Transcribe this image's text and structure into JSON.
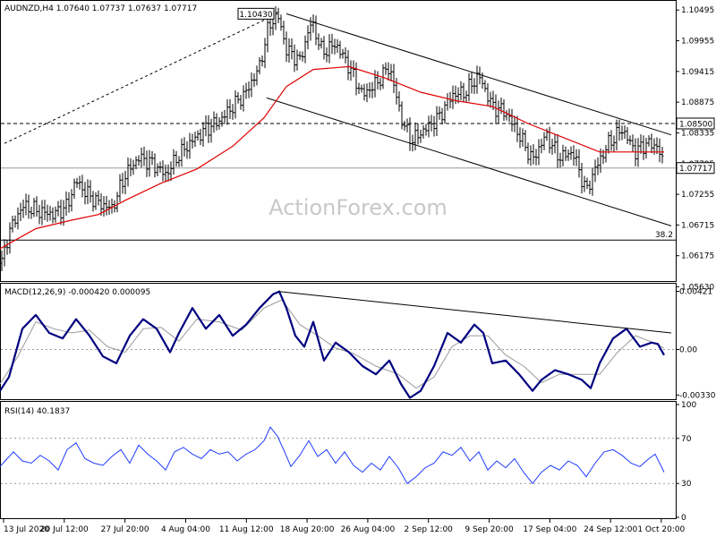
{
  "window": {
    "symbol_line": "AUDNZD,H4  1.07640 1.07737 1.07637 1.07717"
  },
  "watermark": "ActionForex.com",
  "colors": {
    "bars": "#000000",
    "ma": "#e00000",
    "macd": "#000080",
    "signal": "#9a9a9a",
    "rsi": "#1e3cff",
    "levels": "#000000"
  },
  "chart_data": [
    {
      "type": "ohlc",
      "panel": "price",
      "title": "AUDNZD,H4  1.07640 1.07737 1.07637 1.07717",
      "ylim": [
        1.0573,
        1.1064
      ],
      "y_ticks": [
        "1.10495",
        "1.09955",
        "1.09415",
        "1.08875",
        "1.08335",
        "1.07795",
        "1.07255",
        "1.06715",
        "1.06175",
        "1.05630"
      ],
      "x_ticks": [
        "13 Jul 2020",
        "20 Jul 12:00",
        "27 Jul 20:00",
        "4 Aug 04:00",
        "11 Aug 12:00",
        "18 Aug 20:00",
        "26 Aug 04:00",
        "2 Sep 12:00",
        "9 Sep 20:00",
        "17 Sep 04:00",
        "24 Sep 12:00",
        "1 Oct 20:00"
      ],
      "close_path": [
        [
          0,
          1.059
        ],
        [
          10,
          1.066
        ],
        [
          25,
          1.0705
        ],
        [
          45,
          1.0695
        ],
        [
          60,
          1.069
        ],
        [
          75,
          1.0705
        ],
        [
          85,
          1.075
        ],
        [
          95,
          1.073
        ],
        [
          110,
          1.071
        ],
        [
          125,
          1.07
        ],
        [
          140,
          1.076
        ],
        [
          155,
          1.079
        ],
        [
          170,
          1.078
        ],
        [
          185,
          1.076
        ],
        [
          200,
          1.0795
        ],
        [
          215,
          1.082
        ],
        [
          230,
          1.084
        ],
        [
          245,
          1.0855
        ],
        [
          260,
          1.088
        ],
        [
          275,
          1.0905
        ],
        [
          290,
          1.095
        ],
        [
          300,
          1.102
        ],
        [
          310,
          1.1043
        ],
        [
          320,
          1.098
        ],
        [
          335,
          1.096
        ],
        [
          348,
          1.103
        ],
        [
          360,
          1.0975
        ],
        [
          375,
          1.099
        ],
        [
          390,
          1.095
        ],
        [
          405,
          1.09
        ],
        [
          420,
          1.092
        ],
        [
          435,
          1.095
        ],
        [
          450,
          1.085
        ],
        [
          460,
          1.082
        ],
        [
          475,
          1.084
        ],
        [
          490,
          1.086
        ],
        [
          505,
          1.09
        ],
        [
          520,
          1.0905
        ],
        [
          535,
          1.0935
        ],
        [
          550,
          1.088
        ],
        [
          565,
          1.087
        ],
        [
          580,
          1.083
        ],
        [
          595,
          1.0785
        ],
        [
          610,
          1.083
        ],
        [
          625,
          1.079
        ],
        [
          640,
          1.08
        ],
        [
          655,
          1.073
        ],
        [
          665,
          1.077
        ],
        [
          680,
          1.0815
        ],
        [
          695,
          1.084
        ],
        [
          710,
          1.08
        ],
        [
          722,
          1.0815
        ],
        [
          735,
          1.081
        ],
        [
          742,
          1.0772
        ]
      ],
      "ma_path": [
        [
          0,
          1.063
        ],
        [
          40,
          1.0665
        ],
        [
          80,
          1.068
        ],
        [
          110,
          1.069
        ],
        [
          140,
          1.0715
        ],
        [
          180,
          1.0745
        ],
        [
          220,
          1.077
        ],
        [
          260,
          1.081
        ],
        [
          295,
          1.086
        ],
        [
          320,
          1.0915
        ],
        [
          350,
          1.0945
        ],
        [
          390,
          1.095
        ],
        [
          430,
          1.093
        ],
        [
          470,
          1.0905
        ],
        [
          510,
          1.089
        ],
        [
          550,
          1.088
        ],
        [
          590,
          1.085
        ],
        [
          630,
          1.0825
        ],
        [
          670,
          1.08
        ],
        [
          700,
          1.08
        ],
        [
          742,
          1.08
        ]
      ],
      "levels": [
        {
          "label": "1.08500",
          "value": 1.085,
          "style": "dashed"
        },
        {
          "label": "1.07717",
          "value": 1.07717,
          "style": "solid-grey",
          "highlight": true
        },
        {
          "label": "38.2",
          "value": 1.0645,
          "style": "solid"
        }
      ],
      "peak_label": "1.10430",
      "trendlines": [
        {
          "from": [
            5,
            1.0815
          ],
          "to": [
            310,
            1.1043
          ],
          "style": "dotted"
        },
        {
          "from": [
            320,
            1.1043
          ],
          "to": [
            750,
            1.083
          ],
          "style": "solid"
        },
        {
          "from": [
            298,
            1.0895
          ],
          "to": [
            750,
            1.067
          ],
          "style": "solid"
        }
      ]
    },
    {
      "type": "line",
      "panel": "macd",
      "title": "MACD(12,26,9) -0.000420 0.000095",
      "ylim": [
        -0.0036,
        0.0047
      ],
      "y_ticks": [
        "0.00421",
        "0.00",
        "-0.003302"
      ],
      "series": [
        {
          "name": "MACD",
          "values": [
            [
              0,
              -0.003
            ],
            [
              10,
              -0.002
            ],
            [
              25,
              0.0015
            ],
            [
              40,
              0.0025
            ],
            [
              55,
              0.0012
            ],
            [
              70,
              0.0008
            ],
            [
              85,
              0.0022
            ],
            [
              100,
              0.001
            ],
            [
              115,
              -0.0005
            ],
            [
              130,
              -0.001
            ],
            [
              145,
              0.001
            ],
            [
              160,
              0.0022
            ],
            [
              175,
              0.0015
            ],
            [
              190,
              -0.0002
            ],
            [
              200,
              0.0012
            ],
            [
              215,
              0.003
            ],
            [
              230,
              0.0015
            ],
            [
              245,
              0.0025
            ],
            [
              260,
              0.001
            ],
            [
              275,
              0.0018
            ],
            [
              290,
              0.003
            ],
            [
              305,
              0.004
            ],
            [
              312,
              0.0042
            ],
            [
              320,
              0.003
            ],
            [
              330,
              0.001
            ],
            [
              340,
              0.0002
            ],
            [
              350,
              0.002
            ],
            [
              362,
              -0.0008
            ],
            [
              375,
              0.0005
            ],
            [
              390,
              -0.0002
            ],
            [
              405,
              -0.0012
            ],
            [
              420,
              -0.0018
            ],
            [
              435,
              -0.0008
            ],
            [
              448,
              -0.0025
            ],
            [
              458,
              -0.0035
            ],
            [
              470,
              -0.003
            ],
            [
              485,
              -0.0012
            ],
            [
              500,
              0.0012
            ],
            [
              515,
              0.0005
            ],
            [
              530,
              0.0018
            ],
            [
              540,
              0.0012
            ],
            [
              550,
              -0.001
            ],
            [
              565,
              -0.0008
            ],
            [
              580,
              -0.0018
            ],
            [
              595,
              -0.003
            ],
            [
              605,
              -0.0022
            ],
            [
              620,
              -0.0015
            ],
            [
              635,
              -0.0018
            ],
            [
              650,
              -0.0022
            ],
            [
              660,
              -0.0028
            ],
            [
              670,
              -0.001
            ],
            [
              685,
              0.0008
            ],
            [
              700,
              0.0015
            ],
            [
              715,
              0.0002
            ],
            [
              728,
              0.0005
            ],
            [
              735,
              0.0004
            ],
            [
              742,
              -0.0004
            ]
          ]
        },
        {
          "name": "Signal",
          "values": [
            [
              0,
              -0.0025
            ],
            [
              20,
              -0.0005
            ],
            [
              40,
              0.002
            ],
            [
              60,
              0.0015
            ],
            [
              80,
              0.0012
            ],
            [
              100,
              0.0014
            ],
            [
              120,
              0.0002
            ],
            [
              140,
              -0.0002
            ],
            [
              160,
              0.0015
            ],
            [
              180,
              0.0016
            ],
            [
              200,
              0.0006
            ],
            [
              220,
              0.0022
            ],
            [
              245,
              0.002
            ],
            [
              270,
              0.0014
            ],
            [
              295,
              0.003
            ],
            [
              315,
              0.0036
            ],
            [
              335,
              0.0018
            ],
            [
              355,
              0.001
            ],
            [
              375,
              0.0001
            ],
            [
              395,
              -0.0003
            ],
            [
              420,
              -0.0012
            ],
            [
              445,
              -0.0018
            ],
            [
              465,
              -0.0028
            ],
            [
              485,
              -0.002
            ],
            [
              505,
              0.0002
            ],
            [
              525,
              0.001
            ],
            [
              545,
              0.001
            ],
            [
              565,
              -0.0004
            ],
            [
              585,
              -0.0012
            ],
            [
              605,
              -0.0024
            ],
            [
              625,
              -0.0018
            ],
            [
              650,
              -0.0018
            ],
            [
              670,
              -0.0018
            ],
            [
              690,
              -0.0002
            ],
            [
              710,
              0.001
            ],
            [
              730,
              0.0005
            ],
            [
              742,
              0.0001
            ]
          ]
        }
      ],
      "trendlines": [
        {
          "from": [
            312,
            0.0042
          ],
          "to": [
            750,
            0.0012
          ],
          "style": "solid"
        }
      ]
    },
    {
      "type": "line",
      "panel": "rsi",
      "title": "RSI(14) 40.1837",
      "ylim": [
        0,
        100
      ],
      "y_ticks": [
        "100",
        "70",
        "30",
        "0"
      ],
      "levels": [
        70,
        30
      ],
      "series": [
        {
          "name": "RSI",
          "values": [
            [
              0,
              45
            ],
            [
              8,
              52
            ],
            [
              15,
              58
            ],
            [
              25,
              50
            ],
            [
              35,
              48
            ],
            [
              45,
              55
            ],
            [
              55,
              50
            ],
            [
              65,
              42
            ],
            [
              75,
              60
            ],
            [
              85,
              66
            ],
            [
              95,
              52
            ],
            [
              105,
              48
            ],
            [
              115,
              46
            ],
            [
              125,
              54
            ],
            [
              135,
              60
            ],
            [
              145,
              48
            ],
            [
              155,
              64
            ],
            [
              165,
              56
            ],
            [
              175,
              50
            ],
            [
              185,
              42
            ],
            [
              195,
              58
            ],
            [
              205,
              62
            ],
            [
              215,
              56
            ],
            [
              225,
              52
            ],
            [
              235,
              60
            ],
            [
              245,
              56
            ],
            [
              255,
              58
            ],
            [
              265,
              50
            ],
            [
              275,
              56
            ],
            [
              285,
              60
            ],
            [
              295,
              68
            ],
            [
              302,
              80
            ],
            [
              310,
              72
            ],
            [
              318,
              58
            ],
            [
              325,
              45
            ],
            [
              335,
              55
            ],
            [
              345,
              68
            ],
            [
              355,
              54
            ],
            [
              365,
              60
            ],
            [
              375,
              48
            ],
            [
              385,
              58
            ],
            [
              395,
              46
            ],
            [
              405,
              40
            ],
            [
              415,
              48
            ],
            [
              425,
              42
            ],
            [
              435,
              54
            ],
            [
              445,
              44
            ],
            [
              455,
              30
            ],
            [
              465,
              36
            ],
            [
              475,
              44
            ],
            [
              485,
              48
            ],
            [
              495,
              58
            ],
            [
              505,
              55
            ],
            [
              515,
              62
            ],
            [
              525,
              50
            ],
            [
              535,
              58
            ],
            [
              545,
              42
            ],
            [
              555,
              50
            ],
            [
              565,
              44
            ],
            [
              575,
              52
            ],
            [
              585,
              40
            ],
            [
              595,
              30
            ],
            [
              605,
              40
            ],
            [
              615,
              46
            ],
            [
              625,
              42
            ],
            [
              635,
              50
            ],
            [
              645,
              46
            ],
            [
              655,
              36
            ],
            [
              665,
              48
            ],
            [
              675,
              58
            ],
            [
              685,
              60
            ],
            [
              695,
              55
            ],
            [
              705,
              48
            ],
            [
              715,
              45
            ],
            [
              725,
              52
            ],
            [
              732,
              56
            ],
            [
              742,
              40
            ]
          ]
        }
      ]
    }
  ]
}
